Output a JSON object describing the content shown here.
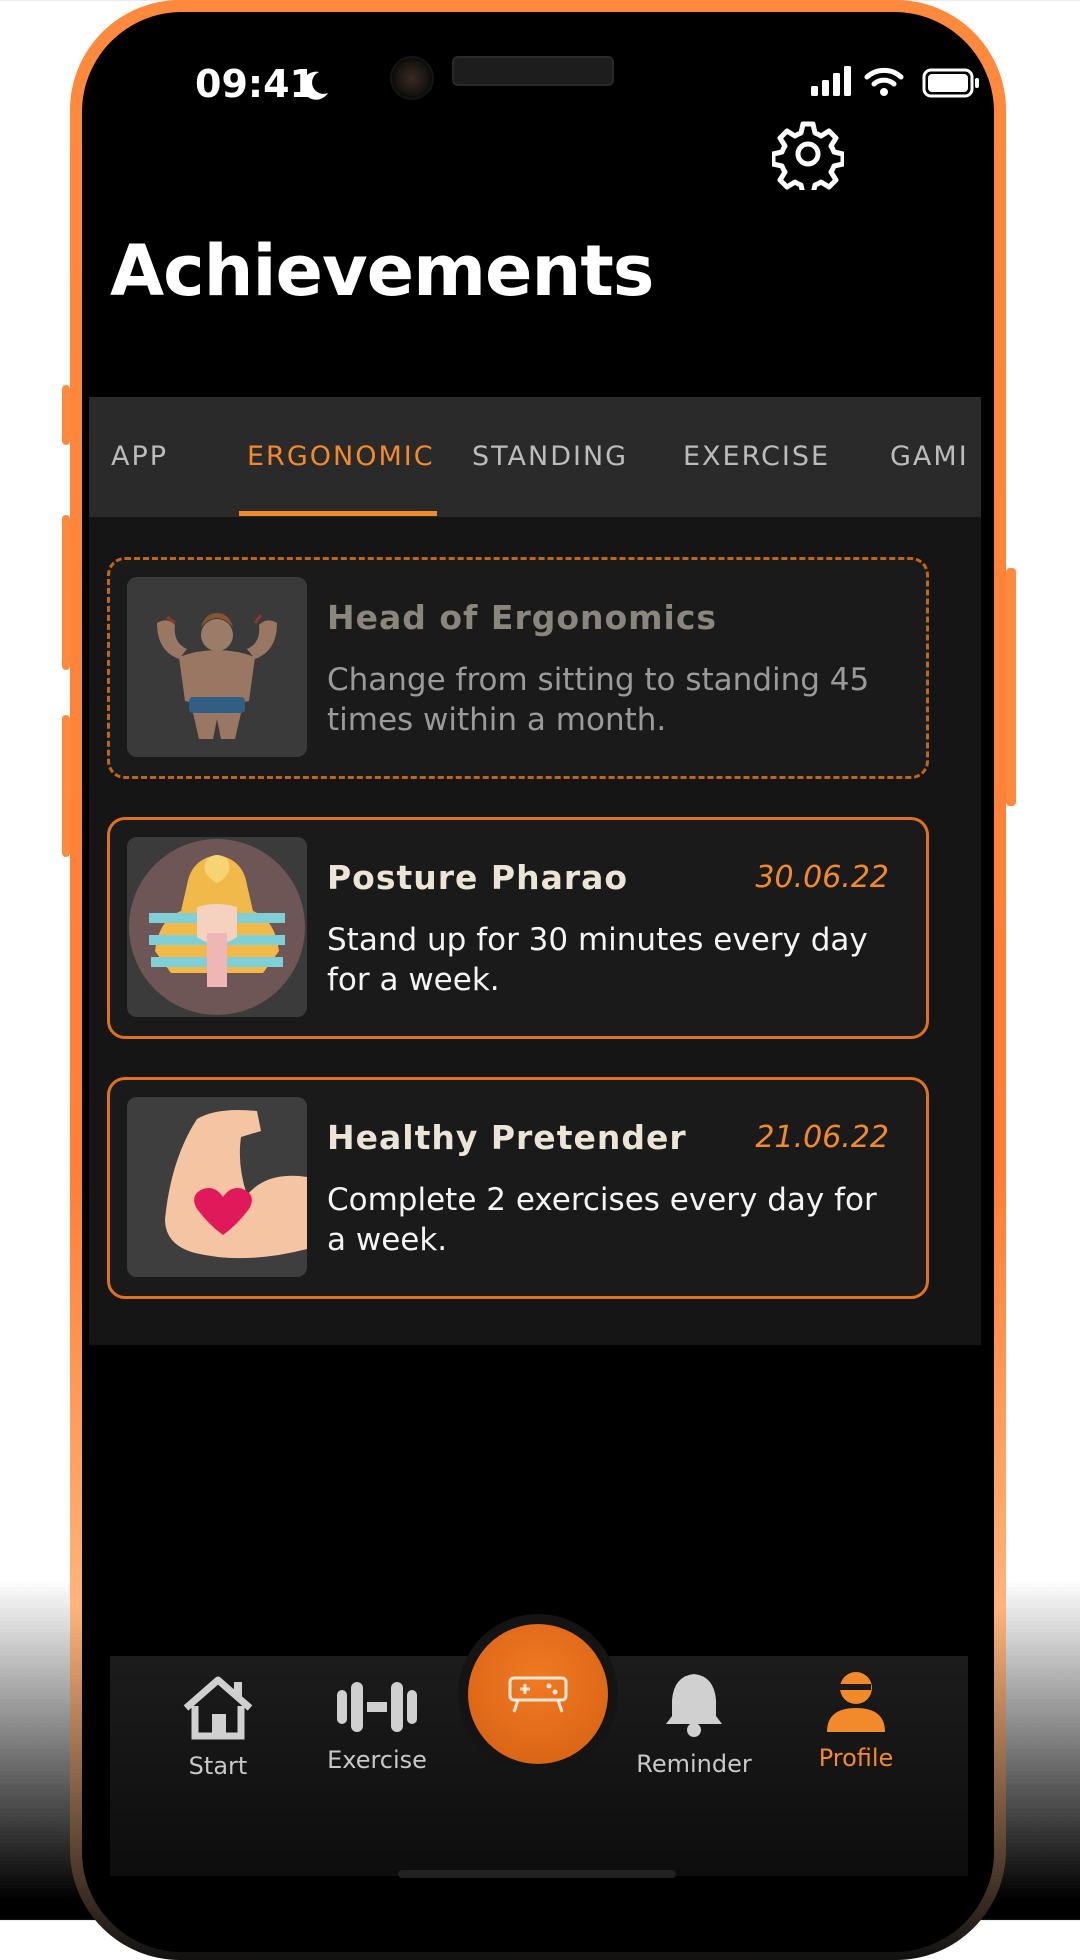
{
  "status": {
    "time": "09:41"
  },
  "header": {
    "title": "Achievements"
  },
  "tabs": [
    {
      "label": "APP",
      "active": false
    },
    {
      "label": "ERGONOMIC",
      "active": true
    },
    {
      "label": "STANDING",
      "active": false
    },
    {
      "label": "EXERCISE",
      "active": false
    },
    {
      "label": "GAMI",
      "active": false
    }
  ],
  "achievements": [
    {
      "title": "Head of Ergonomics",
      "date": "",
      "description": "Change from sitting to standing 45 times within a month.",
      "state": "locked",
      "icon": "bodybuilder-icon"
    },
    {
      "title": "Posture Pharao",
      "date": "30.06.22",
      "description": "Stand up for 30 minutes every day for a week.",
      "state": "earned",
      "icon": "pharaoh-icon"
    },
    {
      "title": "Healthy Pretender",
      "date": "21.06.22",
      "description": "Complete 2 exercises every day for a week.",
      "state": "earned",
      "icon": "flexed-arm-heart-icon"
    }
  ],
  "nav": {
    "items": [
      {
        "label": "Start",
        "icon": "home-icon"
      },
      {
        "label": "Exercise",
        "icon": "dumbbell-icon"
      },
      {
        "label": "",
        "icon": "game-controller-icon"
      },
      {
        "label": "Reminder",
        "icon": "bell-icon"
      },
      {
        "label": "Profile",
        "icon": "profile-icon"
      }
    ]
  },
  "colors": {
    "accent": "#f28a2c",
    "frame": "#ff8a3d",
    "card_bg": "#1a1a1a",
    "tab_bg": "#2a2a2a"
  }
}
